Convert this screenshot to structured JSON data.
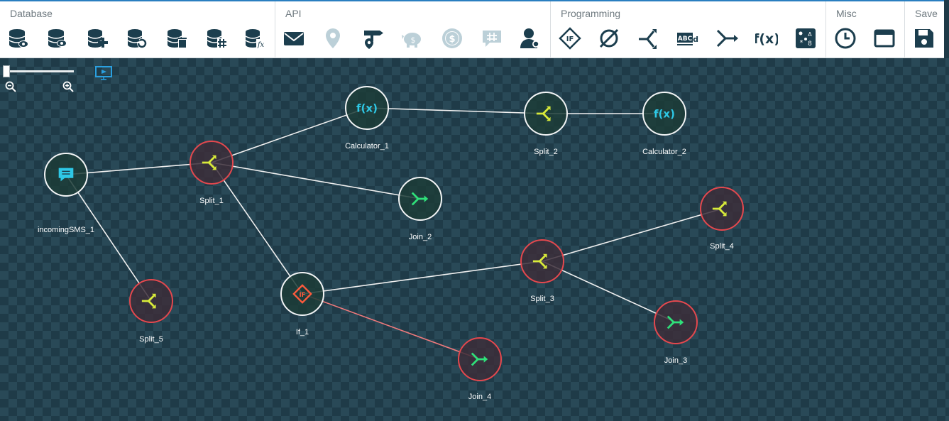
{
  "toolbar": {
    "groups": [
      {
        "label": "Database",
        "tools": [
          "database-view-icon",
          "database-view-alt-icon",
          "database-add-icon",
          "database-refresh-icon",
          "database-delete-icon",
          "database-hash-icon",
          "database-function-icon"
        ]
      },
      {
        "label": "API",
        "tools": [
          "mail-icon",
          "location-pin-icon",
          "signpost-icon",
          "piggy-bank-icon",
          "dollar-coin-icon",
          "hashtag-chat-icon",
          "user-settings-icon"
        ]
      },
      {
        "label": "Programming",
        "tools": [
          "if-diamond-icon",
          "empty-set-icon",
          "split-icon",
          "text-abcd-icon",
          "join-icon",
          "function-fx-icon",
          "random-dice-icon"
        ]
      },
      {
        "label": "Misc",
        "tools": [
          "clock-icon",
          "window-icon"
        ]
      },
      {
        "label": "Save",
        "tools": [
          "save-disk-icon"
        ]
      }
    ]
  },
  "colors": {
    "node_border_ok": "#f2f4f5",
    "node_border_error": "#e4484e",
    "edge_ok": "#f0f0f0",
    "edge_error": "#f07a7c",
    "split_glyph": "#d8ea3a",
    "join_glyph": "#2fe07a",
    "calc_glyph": "#2ec8e6",
    "if_glyph": "#ff5a3c",
    "sms_glyph": "#2ec8e6"
  },
  "nodes": [
    {
      "id": "incomingSMS_1",
      "label": "incomingSMS_1",
      "kind": "sms",
      "state": "ok"
    },
    {
      "id": "Split_1",
      "label": "Split_1",
      "kind": "split",
      "state": "error"
    },
    {
      "id": "Calculator_1",
      "label": "Calculator_1",
      "kind": "calculator",
      "state": "ok"
    },
    {
      "id": "Split_2",
      "label": "Split_2",
      "kind": "split",
      "state": "ok"
    },
    {
      "id": "Calculator_2",
      "label": "Calculator_2",
      "kind": "calculator",
      "state": "ok"
    },
    {
      "id": "Join_2",
      "label": "Join_2",
      "kind": "join",
      "state": "ok"
    },
    {
      "id": "Split_5",
      "label": "Split_5",
      "kind": "split",
      "state": "error"
    },
    {
      "id": "If_1",
      "label": "If_1",
      "kind": "if",
      "state": "ok"
    },
    {
      "id": "Split_3",
      "label": "Split_3",
      "kind": "split",
      "state": "error"
    },
    {
      "id": "Split_4",
      "label": "Split_4",
      "kind": "split",
      "state": "error"
    },
    {
      "id": "Join_3",
      "label": "Join_3",
      "kind": "join",
      "state": "error"
    },
    {
      "id": "Join_4",
      "label": "Join_4",
      "kind": "join",
      "state": "error"
    }
  ],
  "edges": [
    {
      "from": "incomingSMS_1",
      "to": "Split_1",
      "state": "ok"
    },
    {
      "from": "incomingSMS_1",
      "to": "Split_5",
      "state": "ok"
    },
    {
      "from": "Split_1",
      "to": "Calculator_1",
      "state": "ok"
    },
    {
      "from": "Split_1",
      "to": "Join_2",
      "state": "ok"
    },
    {
      "from": "Split_1",
      "to": "If_1",
      "state": "ok"
    },
    {
      "from": "Calculator_1",
      "to": "Split_2",
      "state": "ok"
    },
    {
      "from": "Split_2",
      "to": "Calculator_2",
      "state": "ok"
    },
    {
      "from": "If_1",
      "to": "Split_3",
      "state": "ok"
    },
    {
      "from": "If_1",
      "to": "Join_4",
      "state": "error"
    },
    {
      "from": "Split_3",
      "to": "Split_4",
      "state": "ok"
    },
    {
      "from": "Split_3",
      "to": "Join_3",
      "state": "ok"
    }
  ],
  "zoom": {
    "level": 0.0
  }
}
